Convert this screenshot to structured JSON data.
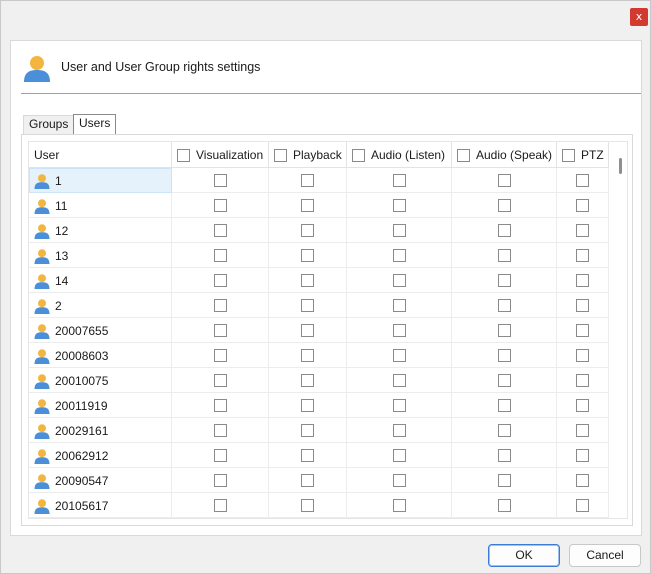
{
  "window": {
    "close_label": "x"
  },
  "header": {
    "title": "User and User Group rights settings",
    "icon": "user-icon"
  },
  "tabs": [
    {
      "label": "Groups",
      "active": false
    },
    {
      "label": "Users",
      "active": true
    }
  ],
  "columns": {
    "user": "User",
    "visualization": "Visualization",
    "playback": "Playback",
    "audio_listen": "Audio (Listen)",
    "audio_speak": "Audio (Speak)",
    "ptz": "PTZ"
  },
  "users": [
    {
      "name": "1",
      "selected": true
    },
    {
      "name": "11"
    },
    {
      "name": "12"
    },
    {
      "name": "13"
    },
    {
      "name": "14"
    },
    {
      "name": "2"
    },
    {
      "name": "20007655"
    },
    {
      "name": "20008603"
    },
    {
      "name": "20010075"
    },
    {
      "name": "20011919"
    },
    {
      "name": "20029161"
    },
    {
      "name": "20062912"
    },
    {
      "name": "20090547"
    },
    {
      "name": "20105617"
    }
  ],
  "buttons": {
    "ok": "OK",
    "cancel": "Cancel"
  },
  "colors": {
    "accent": "#3a7bd5",
    "close": "#d33a2f",
    "selection": "#e5f1fb"
  }
}
